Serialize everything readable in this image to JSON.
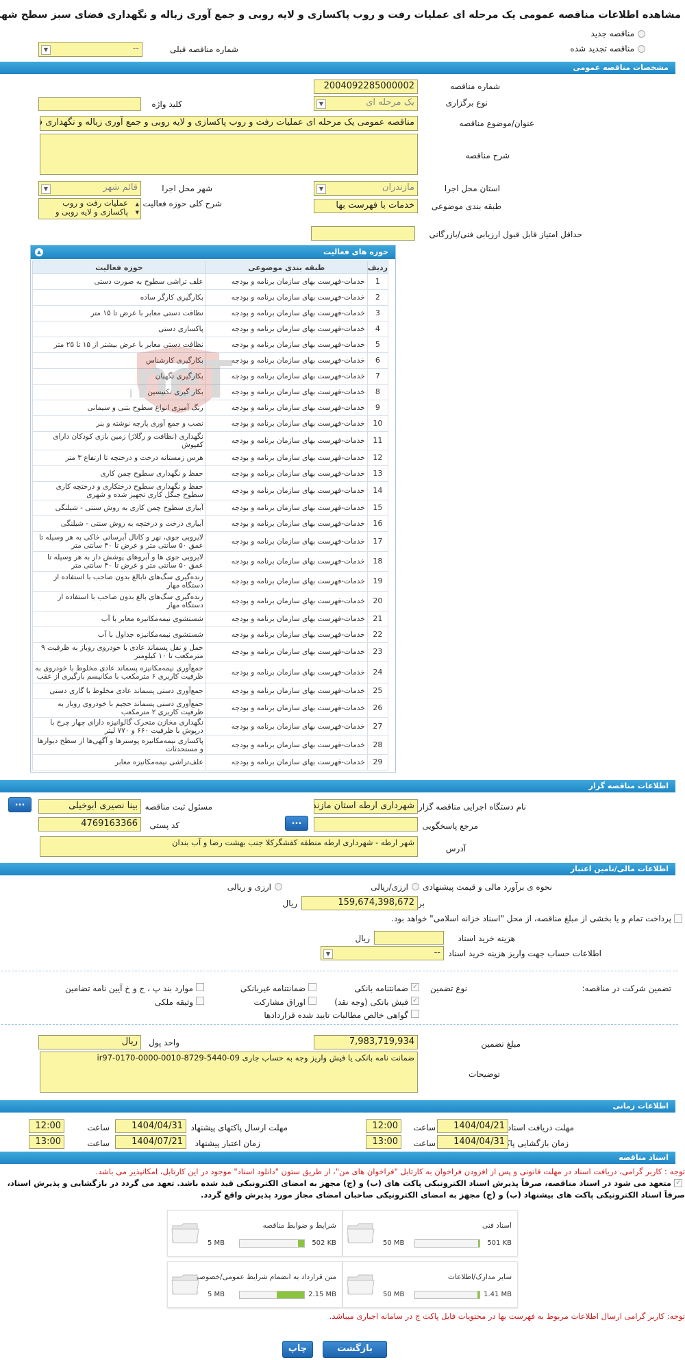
{
  "page_title": "مشاهده اطلاعات مناقصه عمومی یک مرحله ای عملیات رفت و روب پاکسازی و لایه روبی و جمع آوری زباله و نگهداری فضای سبز سطح شهرا رطه",
  "tender_type": {
    "new": "مناقصه جدید",
    "renewed": "مناقصه تجدید شده",
    "prev_label": "شماره مناقصه قبلی",
    "prev_value": "--"
  },
  "general": {
    "header": "مشخصات مناقصه عمومی",
    "number_label": "شماره مناقصه",
    "number": "2004092285000002",
    "holding_label": "نوع برگزاری",
    "holding": "یک مرحله ای",
    "keyword_label": "کلید واژه",
    "keyword": "",
    "subject_label": "عنوان/موضوع مناقصه",
    "subject": "مناقصه عمومی یک مرحله ای عملیات رفت و روب پاکسازی و لایه روبی و جمع آوری زباله و نگهداری فضای سبز",
    "desc_label": "شرح مناقصه",
    "desc": "",
    "province_label": "استان محل اجرا",
    "province": "مازندران",
    "city_label": "شهر محل اجرا",
    "city": "قائم شهر",
    "category_label": "طبقه بندی موضوعی",
    "category": "خدمات با فهرست بها",
    "activity_label": "شرح کلی حوزه فعالیت",
    "activity_line1": "عملیات رفت و روب",
    "activity_line2": "پاکسازی و لایه روبی و",
    "min_score_label": "حداقل امتیاز قابل قبول ارزیابی فنی/بازرگانی",
    "min_score": ""
  },
  "activities": {
    "header": "حوزه های فعالیت",
    "cols": [
      "ردیف",
      "طبقه بندی موضوعی",
      "حوزه فعالیت"
    ],
    "rows": [
      [
        "1",
        "خدمات-فهرست بهای سازمان برنامه و بودجه",
        "علف تراشی سطوح به صورت دستی"
      ],
      [
        "2",
        "خدمات-فهرست بهای سازمان برنامه و بودجه",
        "بکارگیری کارگر ساده"
      ],
      [
        "3",
        "خدمات-فهرست بهای سازمان برنامه و بودجه",
        "نظافت دستی معابر با عرض تا ۱۵ متر"
      ],
      [
        "4",
        "خدمات-فهرست بهای سازمان برنامه و بودجه",
        "پاکسازی دستی"
      ],
      [
        "5",
        "خدمات-فهرست بهای سازمان برنامه و بودجه",
        "نظافت دستی معابر با عرض بیشتر از ۱۵ تا ۲۵ متر"
      ],
      [
        "6",
        "خدمات-فهرست بهای سازمان برنامه و بودجه",
        "بکارگیری کارشناس"
      ],
      [
        "7",
        "خدمات-فهرست بهای سازمان برنامه و بودجه",
        "بکارگیری نگهبان"
      ],
      [
        "8",
        "خدمات-فهرست بهای سازمان برنامه و بودجه",
        "بکار گیری تکنیسین"
      ],
      [
        "9",
        "خدمات-فهرست بهای سازمان برنامه و بودجه",
        "رنگ آمیزی انواع سطوح بتنی و سیمانی"
      ],
      [
        "10",
        "خدمات-فهرست بهای سازمان برنامه و بودجه",
        "نصب و جمع آوری پارچه نوشته و بنر"
      ],
      [
        "11",
        "خدمات-فهرست بهای سازمان برنامه و بودجه",
        "نگهداری (نظافت و رگلاژ) زمین بازی کودکان دارای کفپوش"
      ],
      [
        "12",
        "خدمات-فهرست بهای سازمان برنامه و بودجه",
        "هرس زمستانه درخت و درختچه تا ارتفاع ۳ متر"
      ],
      [
        "13",
        "خدمات-فهرست بهای سازمان برنامه و بودجه",
        "حفظ و نگهداری سطوح چمن کاری"
      ],
      [
        "14",
        "خدمات-فهرست بهای سازمان برنامه و بودجه",
        "حفظ و نگهداری سطوح درختکاری و درختچه کاری سطوح جنگل کاری تجهیز شده و شهری"
      ],
      [
        "15",
        "خدمات-فهرست بهای سازمان برنامه و بودجه",
        "آبیاری سطوح چمن کاری به روش سنتی - شیلنگی"
      ],
      [
        "16",
        "خدمات-فهرست بهای سازمان برنامه و بودجه",
        "آبیاری درخت و درختچه به روش سنتی - شیلنگی"
      ],
      [
        "17",
        "خدمات-فهرست بهای سازمان برنامه و بودجه",
        "لایروبی جوی، نهر و کانال آبرسانی خاکی به هر وسیله تا عمق ۵۰ سانتی متر و عرض تا ۴۰ سانتی متر"
      ],
      [
        "18",
        "خدمات-فهرست بهای سازمان برنامه و بودجه",
        "لایروبی جوی ها و آبروهای پوشش دار به هر وسیله تا عمق ۵۰ سانتی متر و عرض تا ۴۰ سانتی متر"
      ],
      [
        "19",
        "خدمات-فهرست بهای سازمان برنامه و بودجه",
        "زنده‌گیری سگ‌های نابالغ بدون صاحب با استفاده از دستگاه مهار"
      ],
      [
        "20",
        "خدمات-فهرست بهای سازمان برنامه و بودجه",
        "زنده‌گیری سگ‌های بالغ بدون صاحب با استفاده از دستگاه مهار"
      ],
      [
        "21",
        "خدمات-فهرست بهای سازمان برنامه و بودجه",
        "شستشوی نیمه‌مکانیزه معابر با آب"
      ],
      [
        "22",
        "خدمات-فهرست بهای سازمان برنامه و بودجه",
        "شستشوی نیمه‌مکانیزه جداول با آب"
      ],
      [
        "23",
        "خدمات-فهرست بهای سازمان برنامه و بودجه",
        "حمل و نقل پسماند عادی با خودروی روباز به ظرفیت ۹ مترمکعب تا ۱۰ کیلومتر"
      ],
      [
        "24",
        "خدمات-فهرست بهای سازمان برنامه و بودجه",
        "جمع‌آوری نیمه‌مکانیزه پسماند عادی مخلوط با خودروی به ظرفیت کاربری ۶ مترمکعب با مکانیسم بارگیری از عقب"
      ],
      [
        "25",
        "خدمات-فهرست بهای سازمان برنامه و بودجه",
        "جمع‌آوری دستی پسماند عادی مخلوط با گاری دستی"
      ],
      [
        "26",
        "خدمات-فهرست بهای سازمان برنامه و بودجه",
        "جمع‌آوری دستی پسماند حجیم با خودروی روباز به ظرفیت کاربری ۲ مترمکعب"
      ],
      [
        "27",
        "خدمات-فهرست بهای سازمان برنامه و بودجه",
        "نگهداری مخازن متحرک گالوانیزه دارای چهار چرخ با درپوش با ظرفیت ۶۶۰ و ۷۷۰ لیتر"
      ],
      [
        "28",
        "خدمات-فهرست بهای سازمان برنامه و بودجه",
        "پاکسازی نیمه‌مکانیزه پوسترها و آگهی‌ها از سطح دیوارها و مستحدثات"
      ],
      [
        "29",
        "خدمات-فهرست بهای سازمان برنامه و بودجه",
        "علف‌تراشی نیمه‌مکانیزه معابر"
      ]
    ]
  },
  "organizer": {
    "header": "اطلاعات مناقصه گزار",
    "org_label": "نام دستگاه اجرایی مناقصه گزار",
    "org": "شهرداری ارطه استان مازندران",
    "resp_label": "مسئول ثبت مناقصه",
    "resp": "بینا نصیری ابوخیلی",
    "ref_label": "مرجع پاسخگویی",
    "ref": "",
    "postal_label": "کد پستی",
    "postal": "4769163366",
    "address_label": "آدرس",
    "address": "شهر ارطه - شهرداری ارطه منطقه کفشگرکلا جنب بهشت رضا و آب بندان",
    "btn": "..."
  },
  "financial": {
    "header": "اطلاعات مالی/تامین اعتبار",
    "estimate_label": "نحوه ی برآورد مالی و قیمت پیشنهادی",
    "opt1": "ارزی/ریالی",
    "opt2": "ارزی و ریالی",
    "amount_label": "برآورد مالی",
    "amount": "159,674,398,672",
    "currency": "ریال",
    "treasury_note": "پرداخت تمام و یا بخشی از مبلغ مناقصه، از محل \"اسناد خزانه اسلامی\" خواهد بود.",
    "doc_cost_label": "هزینه خرید اسناد",
    "doc_cost": "",
    "doc_cost_unit": "ریال",
    "account_label": "اطلاعات حساب جهت واریز هزینه خرید اسناد",
    "account": "--"
  },
  "guarantee": {
    "participation_label": "تضمین شرکت در مناقصه:",
    "type_label": "نوع تضمین",
    "opts": [
      "ضمانتنامه بانکی",
      "ضمانتنامه غیربانکی",
      "موارد بند پ ، ج و خ آیین نامه تضامین",
      "فیش بانکی (وجه نقد)",
      "اوراق مشارکت",
      "وثیقه ملکی",
      "گواهی خالص مطالبات تایید شده قراردادها"
    ],
    "amount_label": "مبلغ تضمین",
    "amount": "7,983,719,934",
    "unit_label": "واحد پول",
    "unit": "ریال",
    "desc_label": "توضیحات",
    "desc": "ضمانت نامه بانکی یا فیش واریز وجه به حساب جاری ir97-0170-0000-0010-8729-5440-09"
  },
  "timing": {
    "header": "اطلاعات زمانی",
    "receive_label": "مهلت دریافت اسناد",
    "receive_date": "1404/04/21",
    "receive_time": "12:00",
    "send_label": "مهلت ارسال پاکتهای پیشنهاد",
    "send_date": "1404/04/31",
    "send_time": "12:00",
    "open_label": "زمان بازگشایی پاکت ها",
    "open_date": "1404/04/31",
    "open_time": "13:00",
    "valid_label": "زمان اعتبار پیشنهاد",
    "valid_date": "1404/07/21",
    "valid_time": "13:00",
    "time_label": "ساعت"
  },
  "documents": {
    "header": "اسناد مناقصه",
    "note1": "توجه : کاربر گرامی، دریافت اسناد در مهلت قانونی و پس از افزودن فراخوان به کارتابل \"فراخوان های من\"، از طریق ستون \"دانلود اسناد\" موجود در این کارتابل، امکانپذیر می باشد.",
    "note2": "متعهد می شود در اسناد مناقصه، صرفاً پذیرش اسناد الکترونیکی پاکت های (ب) و (ج) مجهز به امضای الکترونیکی قید شده باشد. تعهد می گردد در بازگشایی و پذیرش اسناد،",
    "note3": "صرفاً اسناد الکترونیکی پاکت های بیشنهاد (ب) و (ج) مجهز به امضای الکترونیکی صاحبان امضای مجاز مورد پذیرش واقع گردد.",
    "files": [
      {
        "name": "شرایط و ضوابط مناقصه",
        "size": "502 KB",
        "max": "5 MB",
        "fill": 0.1
      },
      {
        "name": "اسناد فنی",
        "size": "501 KB",
        "max": "50 MB",
        "fill": 0.01
      },
      {
        "name": "متن قرارداد به انضمام شرایط عمومی/خصوصی",
        "size": "2.15 MB",
        "max": "5 MB",
        "fill": 0.43
      },
      {
        "name": "سایر مدارک/اطلاعات",
        "size": "1.41 MB",
        "max": "50 MB",
        "fill": 0.03
      }
    ],
    "note4": "توجه: کاربر گرامی ارسال اطلاعات مربوط به فهرست بها در محتویات فایل پاکت ج در سامانه اجباری میباشد."
  },
  "actions": {
    "return": "بازگشت",
    "print": "چاپ"
  },
  "colors": {
    "header": "#1f86c4",
    "field": "#fbf6a4",
    "note": "#d21e1e",
    "bar": "#8bc53f"
  }
}
